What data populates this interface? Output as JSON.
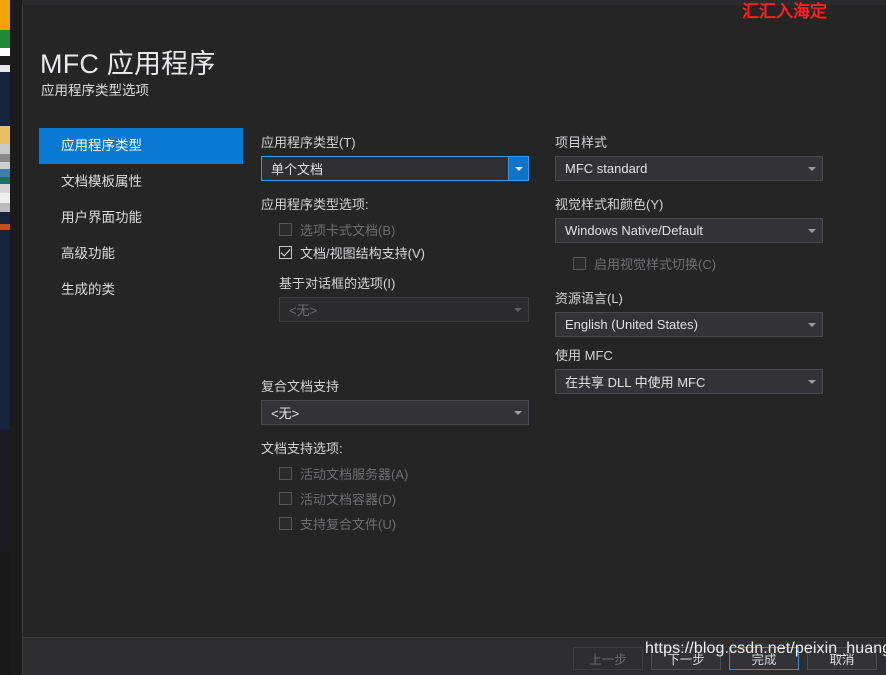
{
  "window": {
    "title": "MFC 应用程序",
    "subtitle": "应用程序类型选项"
  },
  "sidebar": {
    "items": [
      {
        "label": "应用程序类型",
        "selected": true
      },
      {
        "label": "文档模板属性",
        "selected": false
      },
      {
        "label": "用户界面功能",
        "selected": false
      },
      {
        "label": "高级功能",
        "selected": false
      },
      {
        "label": "生成的类",
        "selected": false
      }
    ]
  },
  "left_pane": {
    "app_type_label": "应用程序类型(T)",
    "app_type_value": "单个文档",
    "app_type_options_label": "应用程序类型选项:",
    "checkbox_tabbed_doc": "选项卡式文档(B)",
    "checkbox_doc_view": "文档/视图结构支持(V)",
    "dialog_based_label": "基于对话框的选项(I)",
    "dialog_based_value": "<无>",
    "compound_doc_label": "复合文档支持",
    "compound_doc_value": "<无>",
    "doc_support_label": "文档支持选项:",
    "checkbox_active_server": "活动文档服务器(A)",
    "checkbox_active_container": "活动文档容器(D)",
    "checkbox_compound_files": "支持复合文件(U)"
  },
  "right_pane": {
    "project_style_label": "项目样式",
    "project_style_value": "MFC standard",
    "visual_style_label": "视觉样式和颜色(Y)",
    "visual_style_value": "Windows Native/Default",
    "checkbox_enable_visual_switch": "启用视觉样式切换(C)",
    "resource_language_label": "资源语言(L)",
    "resource_language_value": "English (United States)",
    "use_mfc_label": "使用 MFC",
    "use_mfc_value": "在共享 DLL 中使用 MFC"
  },
  "footer": {
    "back": "上一步",
    "next": "下一步",
    "finish": "完成",
    "cancel": "取消"
  },
  "overlay": {
    "watermark": "https://blog.csdn.net/peixin_huang",
    "red_text": "汇汇入海定"
  },
  "colors": {
    "accent": "#0b7ad4",
    "focus_border": "#3d97e8",
    "dialog_bg": "#252526",
    "footer_bg": "#2d2d30",
    "red": "#ff1f1f"
  }
}
